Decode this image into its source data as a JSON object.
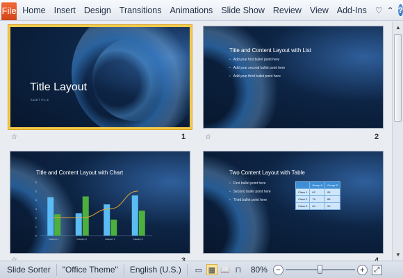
{
  "ribbon": {
    "file_label": "File",
    "tabs": [
      "Home",
      "Insert",
      "Design",
      "Transitions",
      "Animations",
      "Slide Show",
      "Review",
      "View",
      "Add-Ins"
    ],
    "icons": [
      "heart-icon",
      "chevron-up-icon",
      "help-icon"
    ]
  },
  "slides": [
    {
      "number": "1",
      "title": "Title Layout",
      "subtitle": "SUBTITLE"
    },
    {
      "number": "2",
      "title": "Title and Content Layout with List",
      "bullets": [
        "Add your first bullet point here",
        "Add your second bullet point here",
        "Add your third bullet point here"
      ]
    },
    {
      "number": "3",
      "title": "Title and Content Layout with Chart"
    },
    {
      "number": "4",
      "title": "Two Content Layout with Table",
      "bullets": [
        "First bullet point here",
        "Second bullet point here",
        "Third bullet point here"
      ],
      "table": {
        "headers": [
          "",
          "Group A",
          "Group B"
        ],
        "rows": [
          [
            "Class 1",
            "82",
            "95"
          ],
          [
            "Class 2",
            "76",
            "88"
          ],
          [
            "Class 3",
            "84",
            "90"
          ]
        ]
      }
    }
  ],
  "chart_data": {
    "type": "bar",
    "categories": [
      "Category 1",
      "Category 2",
      "Category 3",
      "Category 4"
    ],
    "series": [
      {
        "values": [
          4.3,
          2.5,
          3.5,
          4.5
        ],
        "color": "#5bbcf5"
      },
      {
        "values": [
          2.4,
          4.4,
          1.8,
          2.8
        ],
        "color": "#4caf3e"
      }
    ],
    "line": {
      "values": [
        2,
        2,
        3,
        5
      ],
      "color": "#e8a62c"
    },
    "ylim": [
      0,
      6
    ]
  },
  "status": {
    "view": "Slide Sorter",
    "theme": "\"Office Theme\"",
    "language": "English (U.S.)",
    "zoom": "80%",
    "zoom_fraction": 0.5
  },
  "colors": {
    "file_tab": "#e2571e",
    "selection": "#f2c94c"
  }
}
